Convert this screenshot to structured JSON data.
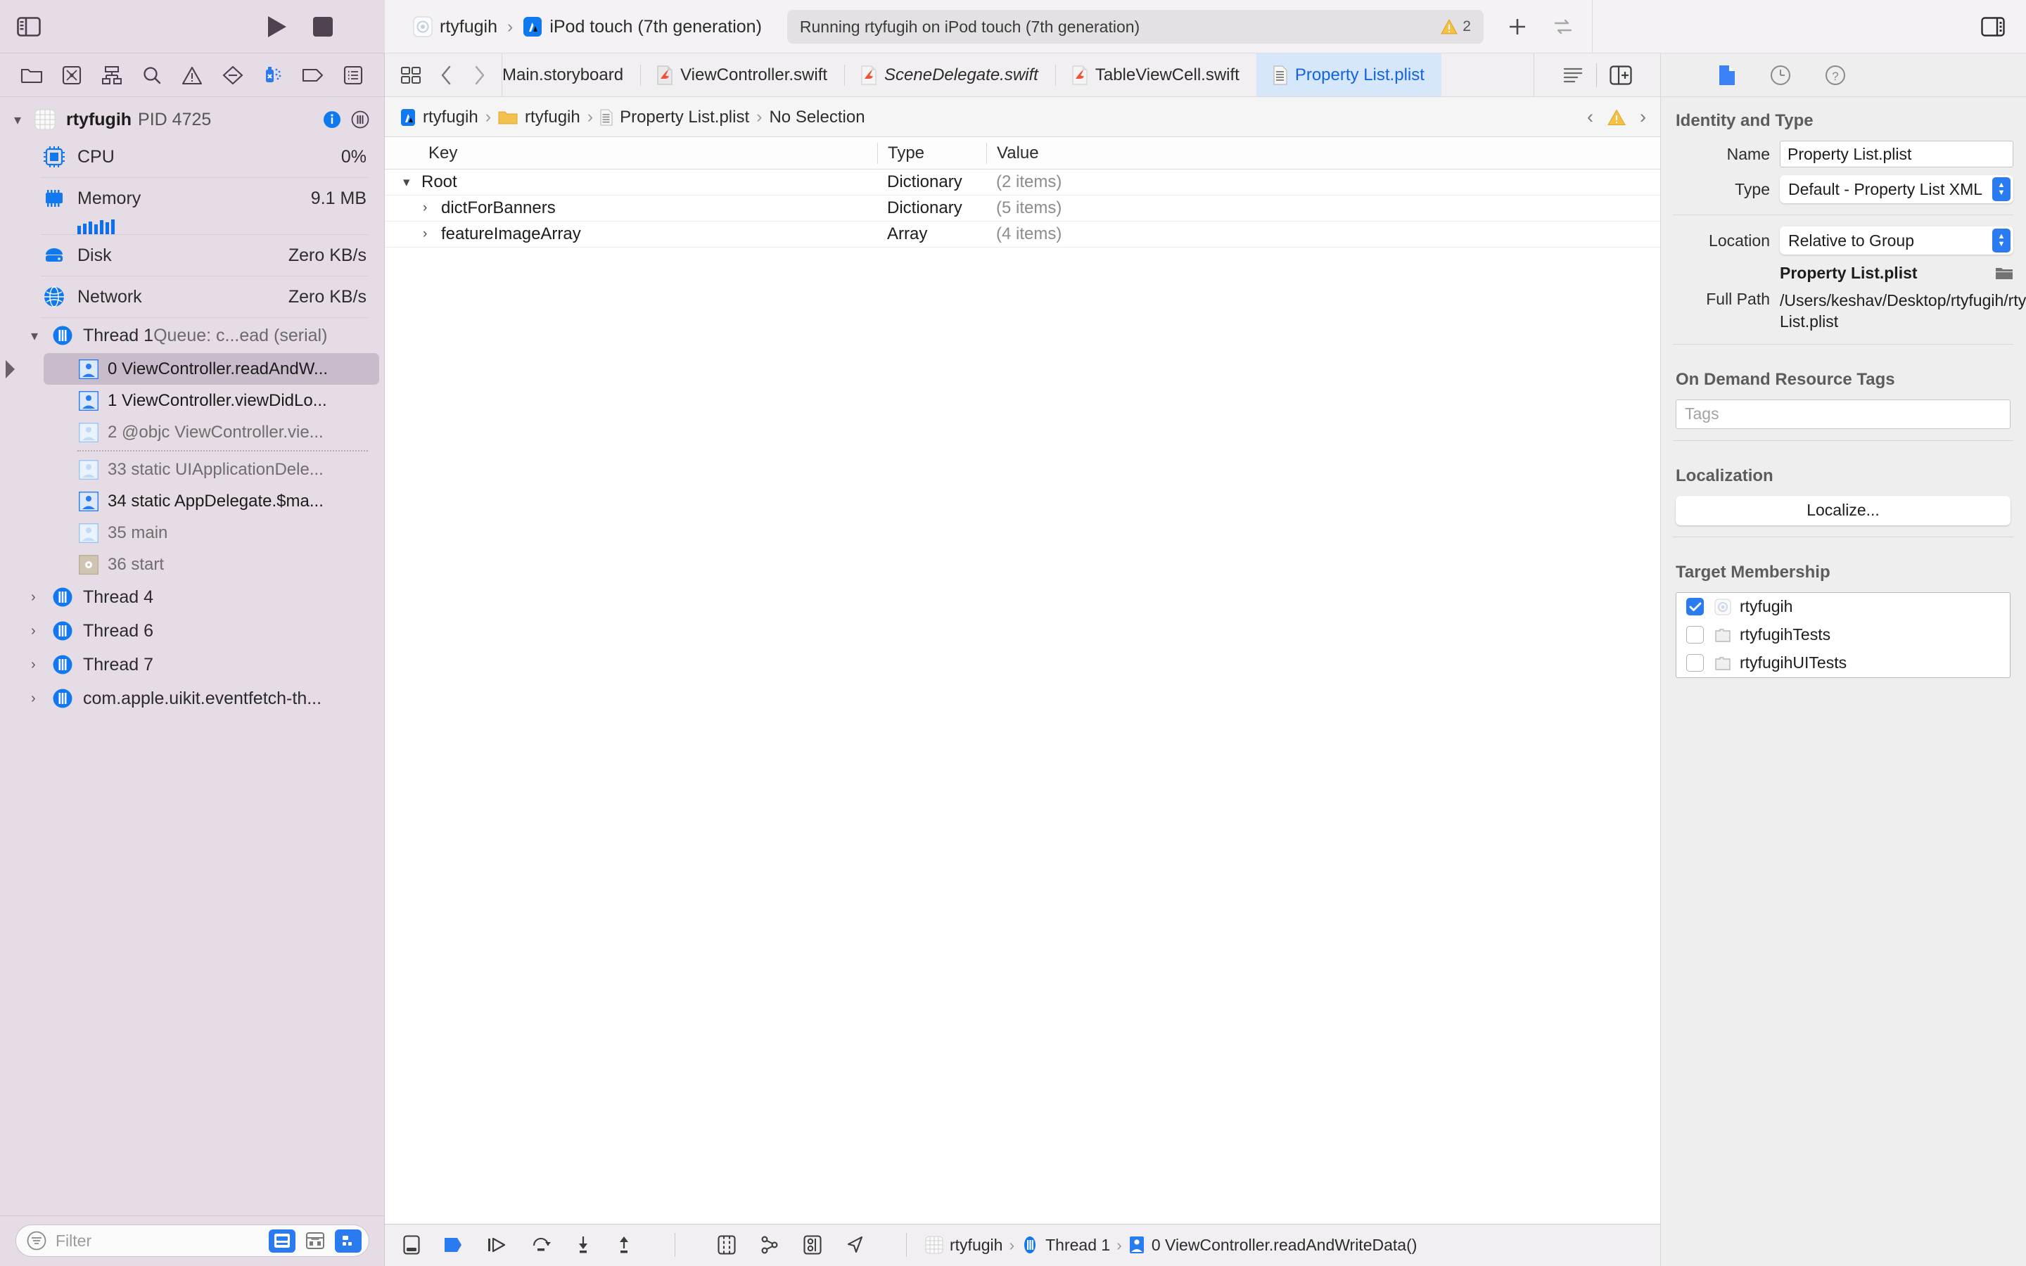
{
  "toolbar": {
    "sidebar_toggle": "sidebar-toggle",
    "run_label": "Run",
    "stop_label": "Stop",
    "scheme_project": "rtyfugih",
    "scheme_destination": "iPod touch (7th generation)",
    "status_text": "Running rtyfugih on iPod touch (7th generation)",
    "warning_count": "2",
    "add_label": "+",
    "inspector_toggle": "inspector-toggle"
  },
  "navigator": {
    "icons": [
      "folder-icon",
      "source-control-icon",
      "symbol-icon",
      "search-icon",
      "warning-icon",
      "breakpoint-icon",
      "debug-spray-icon",
      "tag-icon",
      "report-icon"
    ],
    "process": {
      "name": "rtyfugih",
      "pid": "PID 4725"
    },
    "gauges": [
      {
        "icon": "cpu-icon",
        "label": "CPU",
        "value": "0%"
      },
      {
        "icon": "memory-icon",
        "label": "Memory",
        "value": "9.1 MB"
      },
      {
        "icon": "disk-icon",
        "label": "Disk",
        "value": "Zero KB/s"
      },
      {
        "icon": "network-icon",
        "label": "Network",
        "value": "Zero KB/s"
      }
    ],
    "thread1": {
      "name": "Thread 1 ",
      "queue": "Queue: c...ead (serial)"
    },
    "frames": [
      {
        "label": "0 ViewController.readAndW...",
        "selected": true,
        "dim": false,
        "icon": "swift-frame-icon"
      },
      {
        "label": "1 ViewController.viewDidLo...",
        "selected": false,
        "dim": false,
        "icon": "swift-frame-icon"
      },
      {
        "label": "2 @objc ViewController.vie...",
        "selected": false,
        "dim": true,
        "icon": "swift-frame-icon"
      },
      {
        "label": "33 static UIApplicationDele...",
        "selected": false,
        "dim": true,
        "icon": "swift-frame-icon"
      },
      {
        "label": "34 static AppDelegate.$ma...",
        "selected": false,
        "dim": false,
        "icon": "swift-frame-icon"
      },
      {
        "label": "35 main",
        "selected": false,
        "dim": true,
        "icon": "swift-frame-icon"
      },
      {
        "label": "36 start",
        "selected": false,
        "dim": true,
        "icon": "system-frame-icon"
      }
    ],
    "other_threads": [
      {
        "label": "Thread 4"
      },
      {
        "label": "Thread 6"
      },
      {
        "label": "Thread 7"
      },
      {
        "label": "com.apple.uikit.eventfetch-th..."
      }
    ],
    "filter_placeholder": "Filter",
    "filter_value": ""
  },
  "editor": {
    "tabs": [
      {
        "label": "Main.storyboard",
        "icon": "storyboard-icon",
        "active": false,
        "italic": false
      },
      {
        "label": "ViewController.swift",
        "icon": "swift-file-icon",
        "active": false,
        "italic": false
      },
      {
        "label": "SceneDelegate.swift",
        "icon": "swift-file-icon",
        "active": false,
        "italic": true
      },
      {
        "label": "TableViewCell.swift",
        "icon": "swift-file-icon",
        "active": false,
        "italic": false
      },
      {
        "label": "Property List.plist",
        "icon": "plist-icon",
        "active": true,
        "italic": false
      }
    ],
    "breadcrumb": [
      {
        "label": "rtyfugih",
        "icon": "project-icon"
      },
      {
        "label": "rtyfugih",
        "icon": "folder-icon"
      },
      {
        "label": "Property List.plist",
        "icon": "plist-icon"
      },
      {
        "label": "No Selection",
        "icon": "none"
      }
    ],
    "plist": {
      "columns": [
        "Key",
        "Type",
        "Value"
      ],
      "rows": [
        {
          "key": "Root",
          "type": "Dictionary",
          "value": "(2 items)",
          "indent": 0,
          "twisty": "open"
        },
        {
          "key": "dictForBanners",
          "type": "Dictionary",
          "value": "(5 items)",
          "indent": 1,
          "twisty": "closed"
        },
        {
          "key": "featureImageArray",
          "type": "Array",
          "value": "(4 items)",
          "indent": 1,
          "twisty": "closed"
        }
      ]
    }
  },
  "debugbar": {
    "icons": [
      "show-debug-area-icon",
      "breakpoint-activate-icon",
      "continue-icon",
      "step-over-icon",
      "step-into-icon",
      "step-out-icon",
      "view-debug-icon",
      "view-hierarchy-icon",
      "memory-graph-icon",
      "location-icon"
    ],
    "crumbs": [
      {
        "label": "rtyfugih",
        "icon": "project-icon"
      },
      {
        "label": "Thread 1",
        "icon": "thread-icon"
      },
      {
        "label": "0 ViewController.readAndWriteData()",
        "icon": "frame-icon"
      }
    ]
  },
  "inspector": {
    "tabs": [
      "file-inspector-icon",
      "history-inspector-icon",
      "help-inspector-icon"
    ],
    "identity": {
      "title": "Identity and Type",
      "name_label": "Name",
      "name_value": "Property List.plist",
      "type_label": "Type",
      "type_value": "Default - Property List XML",
      "location_label": "Location",
      "location_value": "Relative to Group",
      "relative_path": "Property List.plist",
      "fullpath_label": "Full Path",
      "fullpath_value": "/Users/keshav/Desktop/rtyfugih/rtyfugih/Property List.plist"
    },
    "odr": {
      "title": "On Demand Resource Tags",
      "tags_placeholder": "Tags",
      "tags_value": ""
    },
    "localization": {
      "title": "Localization",
      "button": "Localize..."
    },
    "target_membership": {
      "title": "Target Membership",
      "items": [
        {
          "label": "rtyfugih",
          "checked": true,
          "icon": "app-target-icon"
        },
        {
          "label": "rtyfugihTests",
          "checked": false,
          "icon": "test-target-icon"
        },
        {
          "label": "rtyfugihUITests",
          "checked": false,
          "icon": "test-target-icon"
        }
      ]
    }
  },
  "colors": {
    "navigator_bg": "#e6dce6",
    "accent_blue": "#2a7bf0",
    "tab_active_bg": "#d6e6fb",
    "tab_active_text": "#1464e0",
    "warning_yellow": "#f0b429",
    "selection_bg": "#c9bcca"
  }
}
